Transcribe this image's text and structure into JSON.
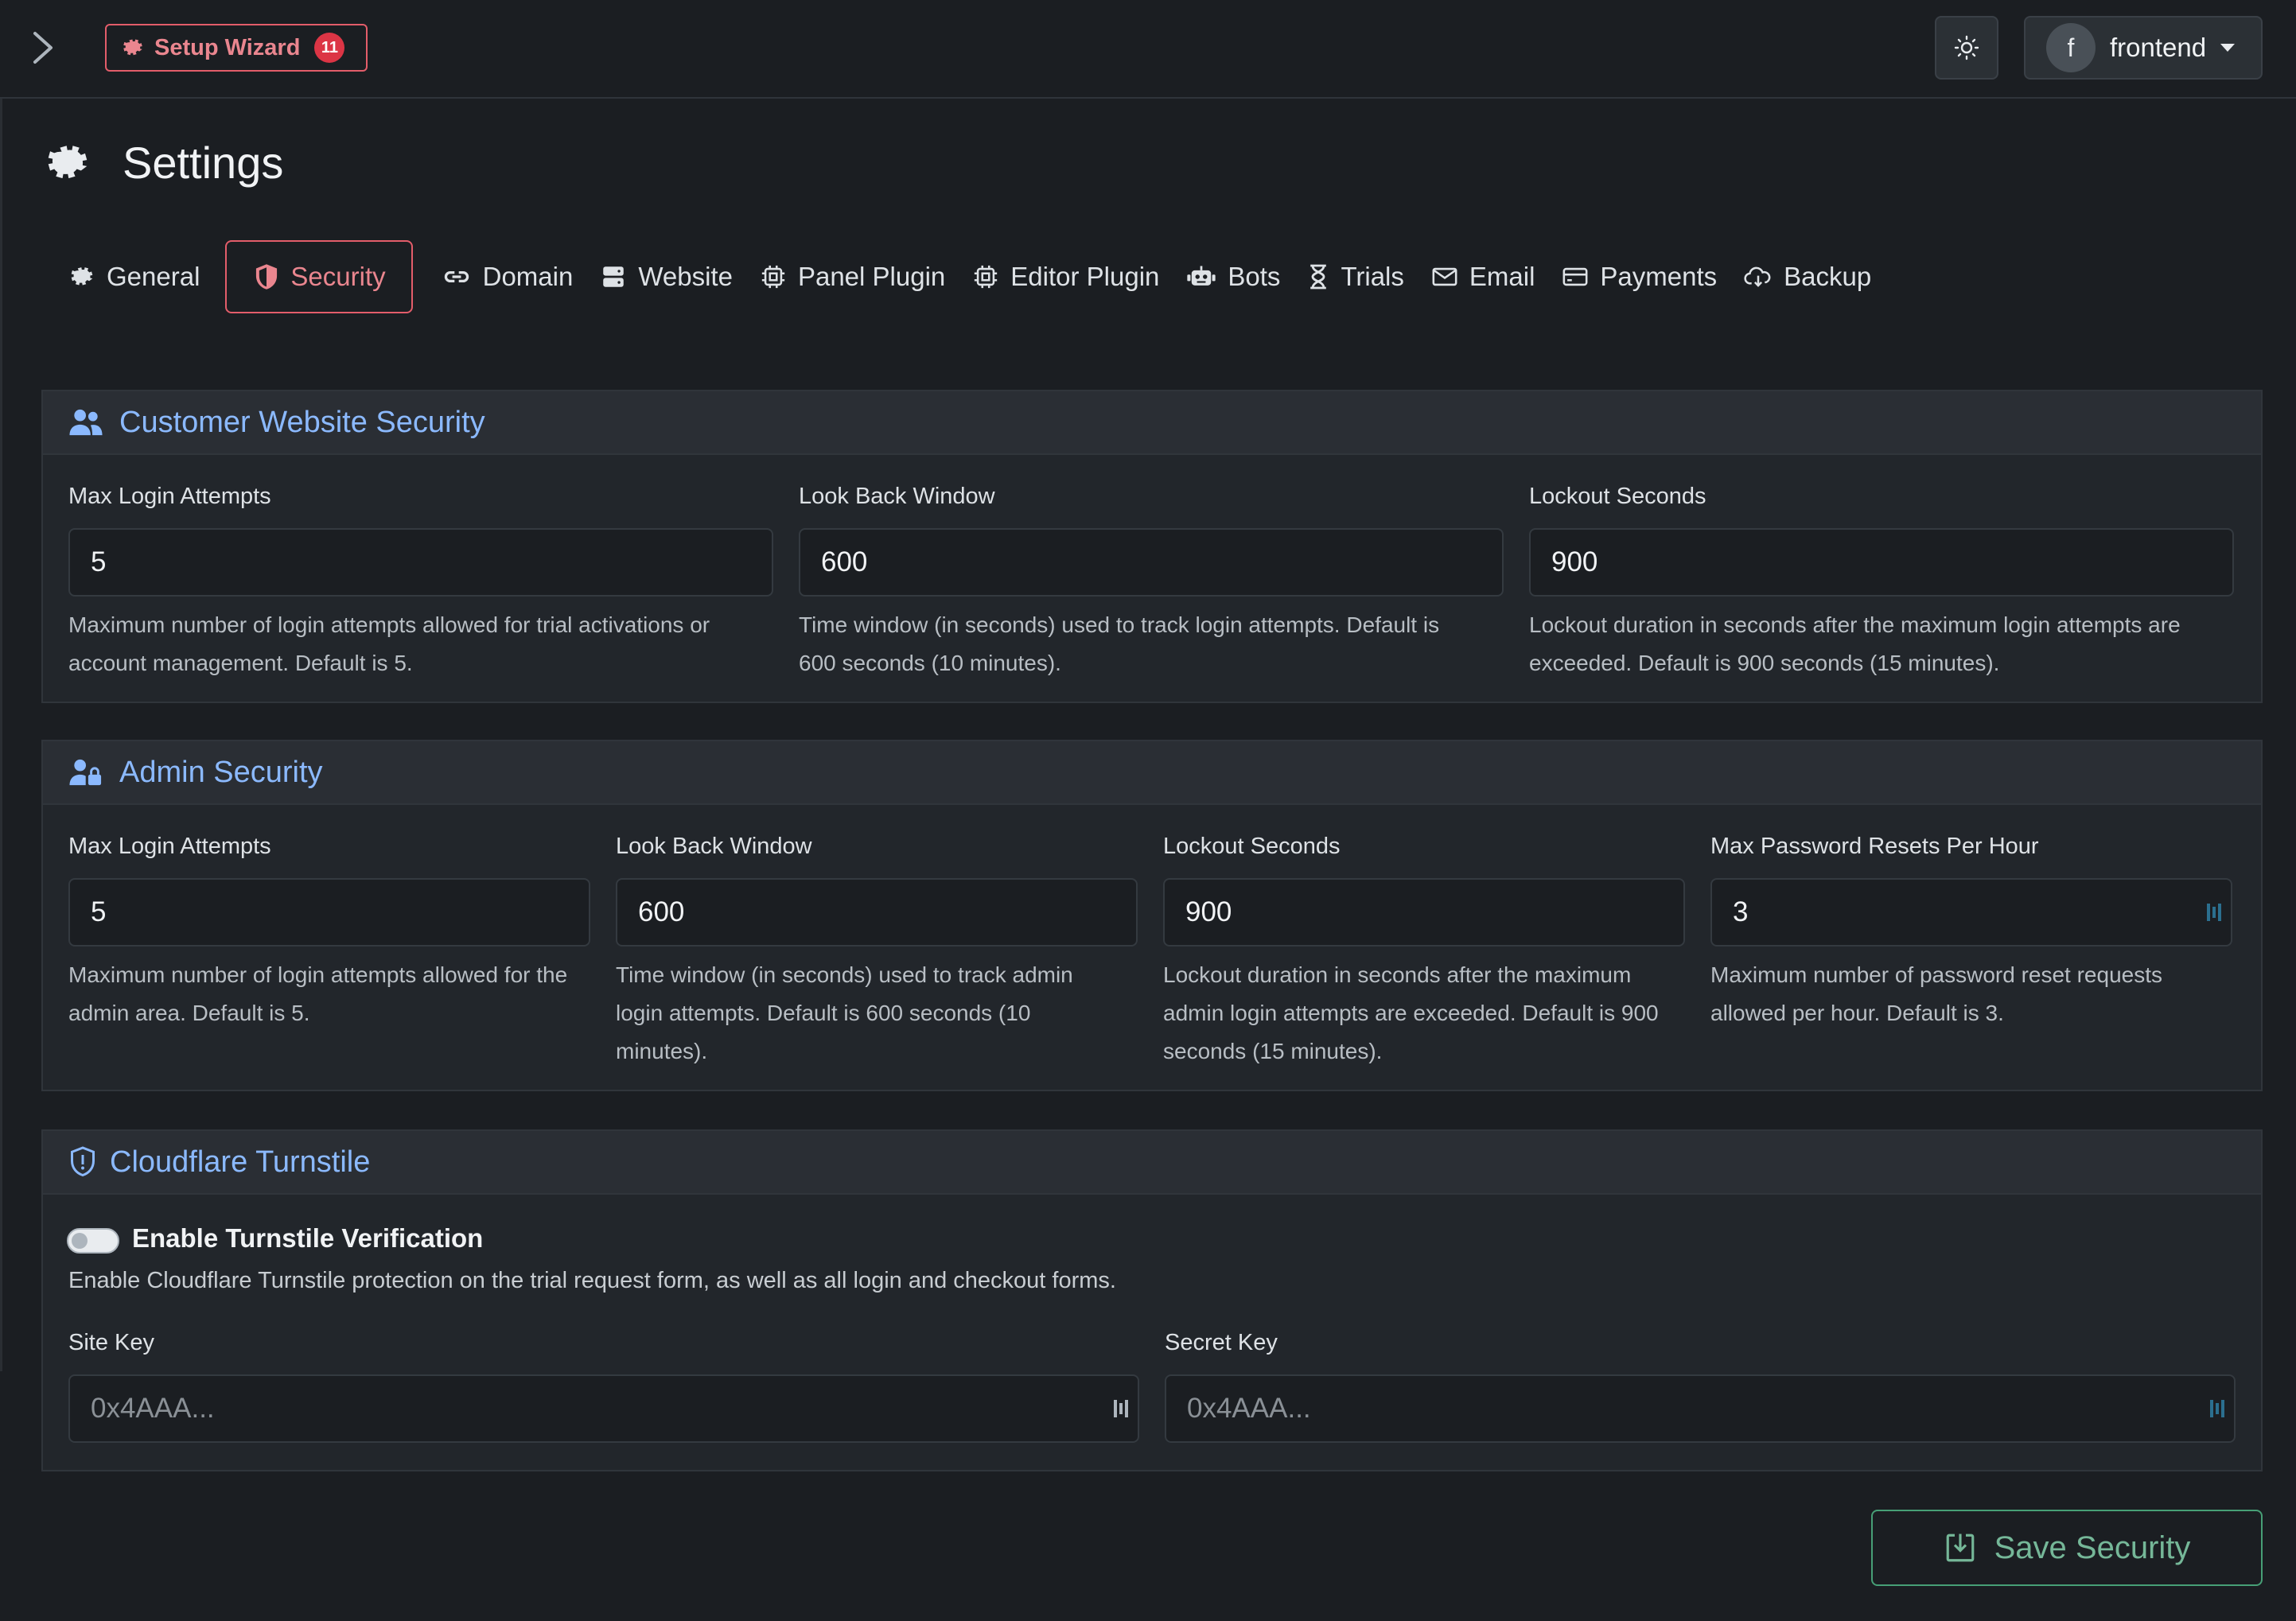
{
  "header": {
    "wizard_label": "Setup Wizard",
    "wizard_badge": "11",
    "user_initial": "f",
    "user_name": "frontend"
  },
  "page": {
    "title": "Settings"
  },
  "tabs": [
    {
      "label": "General",
      "icon": "gear-icon"
    },
    {
      "label": "Security",
      "icon": "shield-icon",
      "active": true
    },
    {
      "label": "Domain",
      "icon": "link-icon"
    },
    {
      "label": "Website",
      "icon": "server-icon"
    },
    {
      "label": "Panel Plugin",
      "icon": "cpu-icon"
    },
    {
      "label": "Editor Plugin",
      "icon": "cpu-icon"
    },
    {
      "label": "Bots",
      "icon": "robot-icon"
    },
    {
      "label": "Trials",
      "icon": "hourglass-icon"
    },
    {
      "label": "Email",
      "icon": "envelope-icon"
    },
    {
      "label": "Payments",
      "icon": "credit-card-icon"
    },
    {
      "label": "Backup",
      "icon": "cloud-download-icon"
    }
  ],
  "customer_security": {
    "title": "Customer Website Security",
    "max_login": {
      "label": "Max Login Attempts",
      "value": "5",
      "help_1": "Maximum number of login attempts allowed for trial activations or",
      "help_2": "account management. Default is 5."
    },
    "look_back": {
      "label": "Look Back Window",
      "value": "600",
      "help_1": "Time window (in seconds) used to track login attempts. Default is",
      "help_2": "600 seconds (10 minutes)."
    },
    "lockout": {
      "label": "Lockout Seconds",
      "value": "900",
      "help_1": "Lockout duration in seconds after the maximum login attempts are",
      "help_2": "exceeded. Default is 900 seconds (15 minutes)."
    }
  },
  "admin_security": {
    "title": "Admin Security",
    "max_login": {
      "label": "Max Login Attempts",
      "value": "5",
      "help_1": "Maximum number of login attempts allowed for the",
      "help_2": "admin area. Default is 5."
    },
    "look_back": {
      "label": "Look Back Window",
      "value": "600",
      "help_1": "Time window (in seconds) used to track admin",
      "help_2": "login attempts. Default is 600 seconds (10",
      "help_3": "minutes)."
    },
    "lockout": {
      "label": "Lockout Seconds",
      "value": "900",
      "help_1": "Lockout duration in seconds after the maximum",
      "help_2": "admin login attempts are exceeded. Default is 900",
      "help_3": "seconds (15 minutes)."
    },
    "max_resets": {
      "label": "Max Password Resets Per Hour",
      "value": "3",
      "help_1": "Maximum number of password reset requests",
      "help_2": "allowed per hour. Default is 3."
    }
  },
  "turnstile": {
    "title": "Cloudflare Turnstile",
    "toggle_label": "Enable Turnstile Verification",
    "toggle_on": false,
    "description": "Enable Cloudflare Turnstile protection on the trial request form, as well as all login and checkout forms.",
    "site_key": {
      "label": "Site Key",
      "placeholder": "0x4AAA..."
    },
    "secret_key": {
      "label": "Secret Key",
      "placeholder": "0x4AAA..."
    }
  },
  "actions": {
    "save_label": "Save Security"
  },
  "colors": {
    "danger": "#e35d6a",
    "accent": "#8bb9fe",
    "success": "#479f76"
  }
}
